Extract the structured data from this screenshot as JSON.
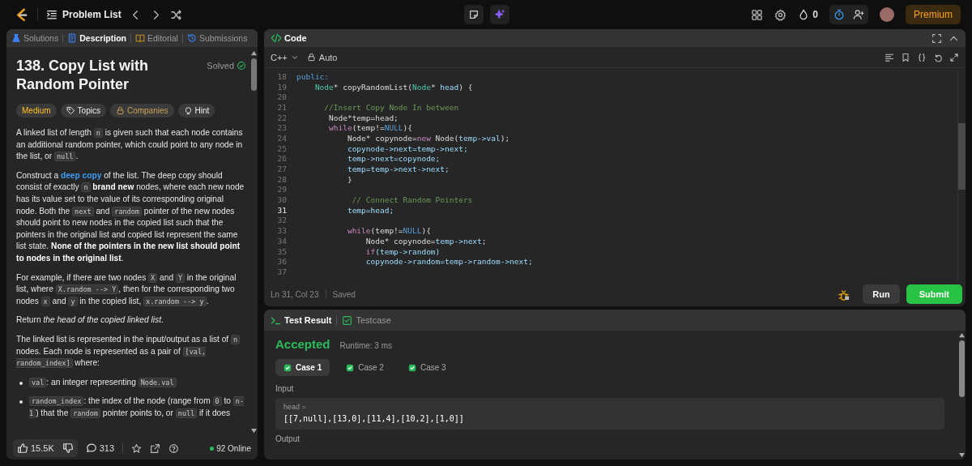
{
  "nav": {
    "problem_list": "Problem List",
    "streak": "0",
    "premium": "Premium"
  },
  "left_tabs": [
    {
      "label": "Solutions",
      "kind": "solutions",
      "selected": false
    },
    {
      "label": "Description",
      "kind": "description",
      "selected": true
    },
    {
      "label": "Editorial",
      "kind": "editorial",
      "selected": false
    },
    {
      "label": "Submissions",
      "kind": "submissions",
      "selected": false
    }
  ],
  "problem": {
    "title": "138. Copy List with Random Pointer",
    "status": "Solved",
    "tags": [
      {
        "label": "Medium",
        "kind": "difficulty"
      },
      {
        "label": "Topics",
        "kind": "topics"
      },
      {
        "label": "Companies",
        "kind": "companies"
      },
      {
        "label": "Hint",
        "kind": "hint"
      }
    ],
    "paragraphs": [
      {
        "kind": "p",
        "segs": [
          {
            "text": "A linked list of length "
          },
          {
            "text": "n",
            "kind": "code"
          },
          {
            "text": " is given such that each node contains an additional random pointer, which could point to any node in the list, or "
          },
          {
            "text": "null",
            "kind": "code"
          },
          {
            "text": "."
          }
        ]
      },
      {
        "kind": "p",
        "segs": [
          {
            "text": "Construct a "
          },
          {
            "text": "deep copy",
            "kind": "link"
          },
          {
            "text": " of the list. The deep copy should consist of exactly "
          },
          {
            "text": "n",
            "kind": "code"
          },
          {
            "text": " brand new",
            "kind": "bold"
          },
          {
            "text": " nodes, where each new node has its value set to the value of its corresponding original node. Both the "
          },
          {
            "text": "next",
            "kind": "code"
          },
          {
            "text": " and "
          },
          {
            "text": "random",
            "kind": "code"
          },
          {
            "text": " pointer of the new nodes should point to new nodes in the copied list such that the pointers in the original list and copied list represent the same list state. "
          },
          {
            "text": "None of the pointers in the new list should point to nodes in the original list",
            "kind": "bold"
          },
          {
            "text": "."
          }
        ]
      },
      {
        "kind": "p",
        "segs": [
          {
            "text": "For example, if there are two nodes "
          },
          {
            "text": "X",
            "kind": "code"
          },
          {
            "text": " and "
          },
          {
            "text": "Y",
            "kind": "code"
          },
          {
            "text": " in the original list, where "
          },
          {
            "text": "X.random --> Y",
            "kind": "code"
          },
          {
            "text": ", then for the corresponding two nodes "
          },
          {
            "text": "x",
            "kind": "code"
          },
          {
            "text": " and "
          },
          {
            "text": "y",
            "kind": "code"
          },
          {
            "text": " in the copied list, "
          },
          {
            "text": "x.random --> y",
            "kind": "code"
          },
          {
            "text": "."
          }
        ]
      },
      {
        "kind": "p",
        "segs": [
          {
            "text": "Return "
          },
          {
            "text": "the head of the copied linked list",
            "kind": "italic"
          },
          {
            "text": "."
          }
        ]
      },
      {
        "kind": "p",
        "segs": [
          {
            "text": "The linked list is represented in the input/output as a list of "
          },
          {
            "text": "n",
            "kind": "code"
          },
          {
            "text": " nodes. Each node is represented as a pair of "
          },
          {
            "text": "[val, random_index]",
            "kind": "code"
          },
          {
            "text": " where:"
          }
        ]
      },
      {
        "kind": "bullet",
        "segs": [
          {
            "text": "val",
            "kind": "code"
          },
          {
            "text": ": an integer representing "
          },
          {
            "text": "Node.val",
            "kind": "code"
          }
        ]
      },
      {
        "kind": "bullet",
        "segs": [
          {
            "text": "random_index",
            "kind": "code"
          },
          {
            "text": ": the index of the node (range from "
          },
          {
            "text": "0",
            "kind": "code"
          },
          {
            "text": " to "
          },
          {
            "text": "n-1",
            "kind": "code"
          },
          {
            "text": ") that the "
          },
          {
            "text": "random",
            "kind": "code"
          },
          {
            "text": " pointer points to, or "
          },
          {
            "text": "null",
            "kind": "code"
          },
          {
            "text": " if it does"
          }
        ]
      }
    ]
  },
  "footer": {
    "likes": "15.5K",
    "comments": "313",
    "online": "92 Online"
  },
  "editor": {
    "title": "Code",
    "language": "C++",
    "mode": "Auto",
    "lines": [
      {
        "n": "18",
        "current": false,
        "tokens": [
          {
            "text": "public:",
            "kind": "kw"
          }
        ]
      },
      {
        "n": "19",
        "current": false,
        "tokens": [
          {
            "text": "    Node",
            "kind": "type"
          },
          {
            "text": "* copyRandomList("
          },
          {
            "text": "Node",
            "kind": "type"
          },
          {
            "text": "* "
          },
          {
            "text": "head",
            "kind": "var"
          },
          {
            "text": ") {"
          }
        ]
      },
      {
        "n": "20",
        "current": false
      },
      {
        "n": "21",
        "current": false,
        "tokens": [
          {
            "text": "      //Insert Copy Node In between",
            "kind": "com"
          }
        ]
      },
      {
        "n": "22",
        "current": false,
        "tokens": [
          {
            "text": "       Node*temp=head;"
          }
        ]
      },
      {
        "n": "23",
        "current": false,
        "tokens": [
          {
            "text": "       while",
            "kind": "ctl"
          },
          {
            "text": "(temp!="
          },
          {
            "text": "NULL",
            "kind": "kw"
          },
          {
            "text": "){"
          }
        ]
      },
      {
        "n": "24",
        "current": false,
        "tokens": [
          {
            "text": "           Node* copynode="
          },
          {
            "text": "new",
            "kind": "ctl"
          },
          {
            "text": " Node("
          },
          {
            "text": "temp->val",
            "kind": "var"
          },
          {
            "text": ");"
          }
        ]
      },
      {
        "n": "25",
        "current": false,
        "tokens": [
          {
            "text": "           copynode->next=temp->next;",
            "kind": "var"
          }
        ]
      },
      {
        "n": "26",
        "current": false,
        "tokens": [
          {
            "text": "           temp->next=copynode;",
            "kind": "var"
          }
        ]
      },
      {
        "n": "27",
        "current": false,
        "tokens": [
          {
            "text": "           temp=temp->next->next;",
            "kind": "var"
          }
        ]
      },
      {
        "n": "28",
        "current": false,
        "tokens": [
          {
            "text": "           }"
          }
        ]
      },
      {
        "n": "29",
        "current": false
      },
      {
        "n": "30",
        "current": false,
        "tokens": [
          {
            "text": "            // Connect Random Pointers",
            "kind": "com"
          }
        ]
      },
      {
        "n": "31",
        "current": true,
        "tokens": [
          {
            "text": "           temp=head;",
            "kind": "var"
          }
        ]
      },
      {
        "n": "32",
        "current": false
      },
      {
        "n": "33",
        "current": false,
        "tokens": [
          {
            "text": "           while",
            "kind": "ctl"
          },
          {
            "text": "(temp!="
          },
          {
            "text": "NULL",
            "kind": "kw"
          },
          {
            "text": "){"
          }
        ]
      },
      {
        "n": "34",
        "current": false,
        "tokens": [
          {
            "text": "               Node* copynode="
          },
          {
            "text": "temp->next",
            "kind": "var"
          },
          {
            "text": ";"
          }
        ]
      },
      {
        "n": "35",
        "current": false,
        "tokens": [
          {
            "text": "               if",
            "kind": "ctl"
          },
          {
            "text": "(temp->random)",
            "kind": "var"
          }
        ]
      },
      {
        "n": "36",
        "current": false,
        "tokens": [
          {
            "text": "               copynode->random=temp->random->next;",
            "kind": "var"
          }
        ]
      },
      {
        "n": "37",
        "current": false
      }
    ],
    "position": "Ln 31, Col 23",
    "save_state": "Saved",
    "run": "Run",
    "submit": "Submit"
  },
  "results": {
    "tabs": [
      {
        "label": "Test Result",
        "kind": "result",
        "selected": true
      },
      {
        "label": "Testcase",
        "kind": "testcase",
        "selected": false
      }
    ],
    "verdict": "Accepted",
    "runtime": "Runtime: 3 ms",
    "cases": [
      {
        "label": "Case 1",
        "selected": true,
        "passed": true
      },
      {
        "label": "Case 2",
        "selected": false,
        "passed": true
      },
      {
        "label": "Case 3",
        "selected": false,
        "passed": true
      }
    ],
    "input_label": "Input",
    "var_name": "head =",
    "input_value": "[[7,null],[13,0],[11,4],[10,2],[1,0]]",
    "output_label": "Output"
  }
}
